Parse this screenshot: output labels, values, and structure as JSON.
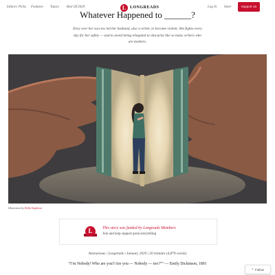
{
  "nav": {
    "left_links": [
      "Editors' Picks",
      "Features",
      "Topics",
      "Best Of 2020"
    ],
    "brand_logo_letter": "L",
    "brand_name": "LONGREADS",
    "right_links": [
      "Log In",
      "Store"
    ],
    "support_label": "Support Us"
  },
  "article": {
    "headline": "Whatever Happened to ______?",
    "dek": "Envy over her success led her husband, also a writer, to become violent. She fights every day for her safety — and to avoid being relegated to obscurity like so many writers who are mothers.",
    "illustration_caption_prefix": "Illustration by",
    "illustrator": "Holly Stapleton",
    "meta": "Anonymous | Longreads | January 2020 | 20 minutes (4,879 words)",
    "epigraph": "“I’m Nobody! Who are you?/Are you — Nobody — too?”” — Emily Dickinson, 1891"
  },
  "funding": {
    "badge_letter": "L",
    "title": "This story was funded by Longreads Members",
    "text": "Join and help support great storytelling"
  },
  "follow": {
    "icon": "plus-icon",
    "label": "Follow"
  },
  "colors": {
    "accent": "#c8102e",
    "hero_background": "#3e3c3e"
  }
}
